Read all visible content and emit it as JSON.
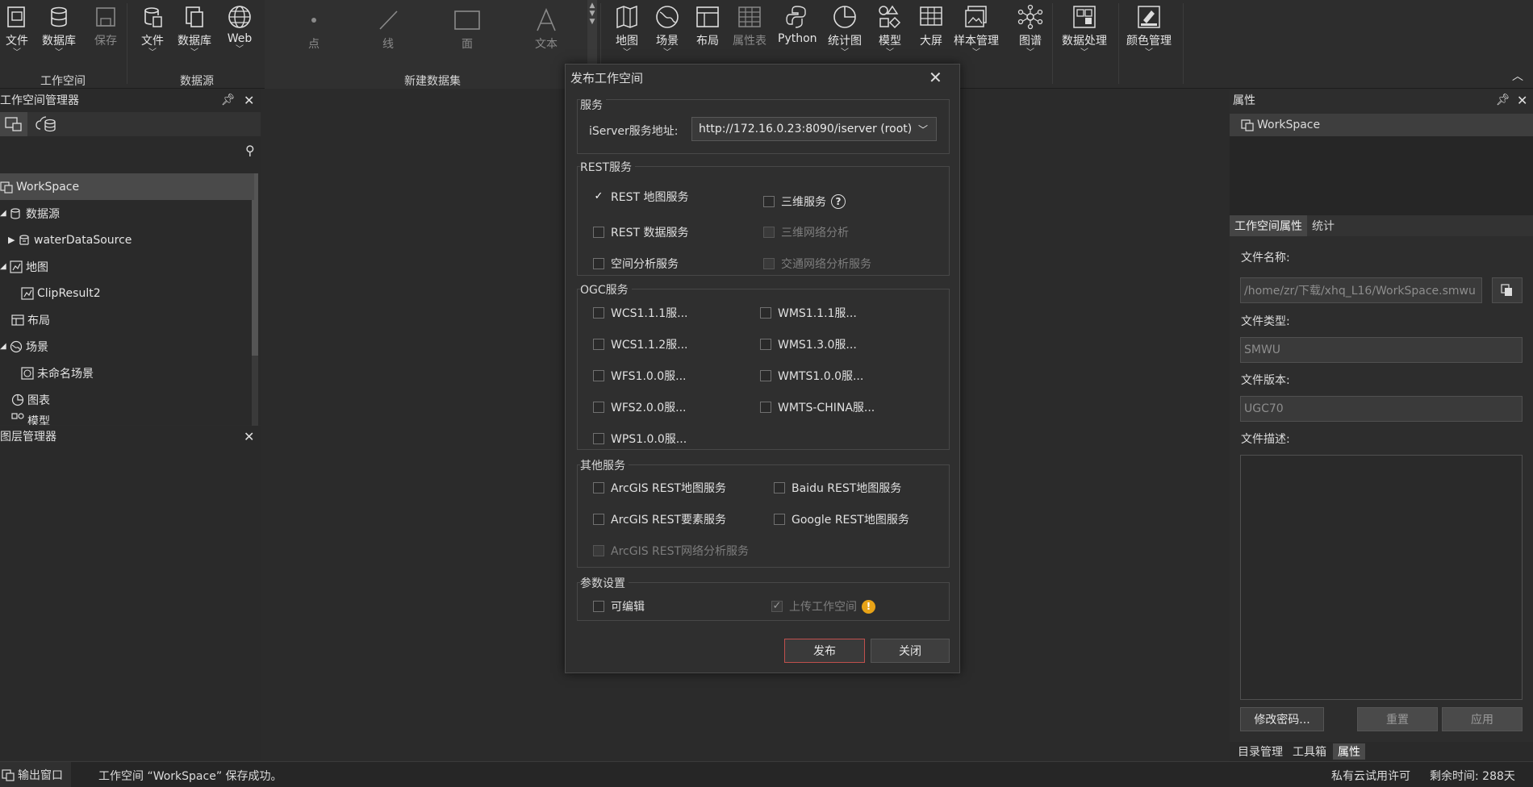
{
  "ribbon": {
    "workspace_group": {
      "label": "工作空间",
      "buttons": [
        {
          "label": "文件",
          "icon": "file-icon"
        },
        {
          "label": "数据库",
          "icon": "database-icon"
        },
        {
          "label": "保存",
          "icon": "save-icon"
        }
      ]
    },
    "datasource_group": {
      "label": "数据源",
      "buttons": [
        {
          "label": "文件",
          "icon": "file-datasource-icon"
        },
        {
          "label": "数据库",
          "icon": "database-datasource-icon"
        },
        {
          "label": "Web",
          "icon": "globe-icon"
        }
      ]
    },
    "new_dataset_group": {
      "label": "新建数据集",
      "buttons": [
        {
          "label": "点",
          "icon": "point-icon"
        },
        {
          "label": "线",
          "icon": "line-icon"
        },
        {
          "label": "面",
          "icon": "polygon-icon"
        },
        {
          "label": "文本",
          "icon": "text-icon"
        }
      ]
    },
    "main_buttons": [
      {
        "label": "地图",
        "icon": "map-icon"
      },
      {
        "label": "场景",
        "icon": "scene-icon"
      },
      {
        "label": "布局",
        "icon": "layout-icon"
      },
      {
        "label": "属性表",
        "icon": "attribute-table-icon"
      },
      {
        "label": "Python",
        "icon": "python-icon"
      },
      {
        "label": "统计图",
        "icon": "pie-chart-icon"
      },
      {
        "label": "模型",
        "icon": "model-icon"
      },
      {
        "label": "大屏",
        "icon": "dashboard-icon"
      },
      {
        "label": "样本管理",
        "icon": "sample-icon"
      },
      {
        "label": "图谱",
        "icon": "graph-icon"
      },
      {
        "label": "数据处理",
        "icon": "data-processing-icon"
      },
      {
        "label": "颜色管理",
        "icon": "color-icon"
      }
    ]
  },
  "workspace_manager": {
    "title": "工作空间管理器",
    "tree": [
      {
        "label": "WorkSpace",
        "icon": "workspace-icon"
      },
      {
        "label": "数据源",
        "icon": "datasource-icon"
      },
      {
        "label": "waterDataSource",
        "icon": "datasource-item-icon"
      },
      {
        "label": "地图",
        "icon": "maps-icon"
      },
      {
        "label": "ClipResult2",
        "icon": "map-item-icon"
      },
      {
        "label": "布局",
        "icon": "layouts-icon"
      },
      {
        "label": "场景",
        "icon": "scenes-icon"
      },
      {
        "label": "未命名场景",
        "icon": "scene-item-icon"
      },
      {
        "label": "图表",
        "icon": "charts-icon"
      },
      {
        "label": "模型",
        "icon": "models-icon"
      }
    ]
  },
  "layer_manager": {
    "title": "图层管理器"
  },
  "dialog": {
    "title": "发布工作空间",
    "service_section": "服务",
    "iserver_label": "iServer服务地址:",
    "iserver_value": "http://172.16.0.23:8090/iserver (root)",
    "rest_section": "REST服务",
    "rest": {
      "map": "REST 地图服务",
      "data": "REST 数据服务",
      "spatial": "空间分析服务",
      "3d": "三维服务",
      "3dnet": "三维网络分析",
      "traffic": "交通网络分析服务"
    },
    "ogc_section": "OGC服务",
    "ogc": {
      "wcs111": "WCS1.1.1服...",
      "wcs112": "WCS1.1.2服...",
      "wfs100": "WFS1.0.0服...",
      "wfs200": "WFS2.0.0服...",
      "wps100": "WPS1.0.0服...",
      "wms111": "WMS1.1.1服...",
      "wms130": "WMS1.3.0服...",
      "wmts100": "WMTS1.0.0服...",
      "wmtschina": "WMTS-CHINA服..."
    },
    "other_section": "其他服务",
    "other": {
      "arcgis_map": "ArcGIS REST地图服务",
      "arcgis_feature": "ArcGIS REST要素服务",
      "arcgis_network": "ArcGIS REST网络分析服务",
      "baidu": "Baidu REST地图服务",
      "google": "Google REST地图服务"
    },
    "param_section": "参数设置",
    "editable": "可编辑",
    "upload": "上传工作空间",
    "publish_button": "发布",
    "close_button": "关闭"
  },
  "properties": {
    "title": "属性",
    "selected": "WorkSpace",
    "tabs": [
      "工作空间属性",
      "统计"
    ],
    "file_name_label": "文件名称:",
    "file_name_value": "/home/zr/下载/xhq_L16/WorkSpace.smwu",
    "file_type_label": "文件类型:",
    "file_type_value": "SMWU",
    "file_version_label": "文件版本:",
    "file_version_value": "UGC70",
    "file_desc_label": "文件描述:",
    "change_password": "修改密码...",
    "reset": "重置",
    "apply": "应用",
    "bottom_tabs": [
      "目录管理",
      "工具箱",
      "属性"
    ]
  },
  "status": {
    "output_window": "输出窗口",
    "message": "工作空间 “WorkSpace” 保存成功。",
    "license": "私有云试用许可",
    "remaining": "剩余时间: 288天"
  },
  "colors": {
    "accent_border": "#c0504d",
    "warning": "#e8a317"
  }
}
